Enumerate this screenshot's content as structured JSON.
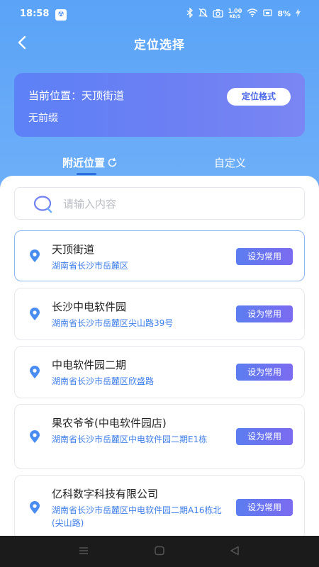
{
  "status_bar": {
    "time": "18:58",
    "notification_badge": "☢",
    "speed_top": "1.00",
    "speed_unit": "KB/S",
    "battery": "8%"
  },
  "header": {
    "title": "定位选择"
  },
  "current_location": {
    "label": "当前位置：天顶街道",
    "prefix": "无前缀",
    "format_button": "定位格式"
  },
  "tabs": {
    "nearby": "附近位置",
    "custom": "自定义"
  },
  "search": {
    "placeholder": "请输入内容"
  },
  "locations": [
    {
      "name": "天顶街道",
      "address": "湖南省长沙市岳麓区",
      "button": "设为常用"
    },
    {
      "name": "长沙中电软件园",
      "address": "湖南省长沙市岳麓区尖山路39号",
      "button": "设为常用"
    },
    {
      "name": "中电软件园二期",
      "address": "湖南省长沙市岳麓区欣盛路",
      "button": "设为常用"
    },
    {
      "name": "果农爷爷(中电软件园店)",
      "address": "湖南省长沙市岳麓区中电软件园二期E1栋",
      "button": "设为常用"
    },
    {
      "name": "亿科数字科技有限公司",
      "address": "湖南省长沙市岳麓区中电软件园二期A16栋北(尖山路)",
      "button": "设为常用"
    }
  ],
  "colors": {
    "hero_blue": "#5aa3f7",
    "card_indigo": "#6c7ff3",
    "address_blue": "#3f7ee8",
    "nav_bar": "#1b1b1b"
  }
}
